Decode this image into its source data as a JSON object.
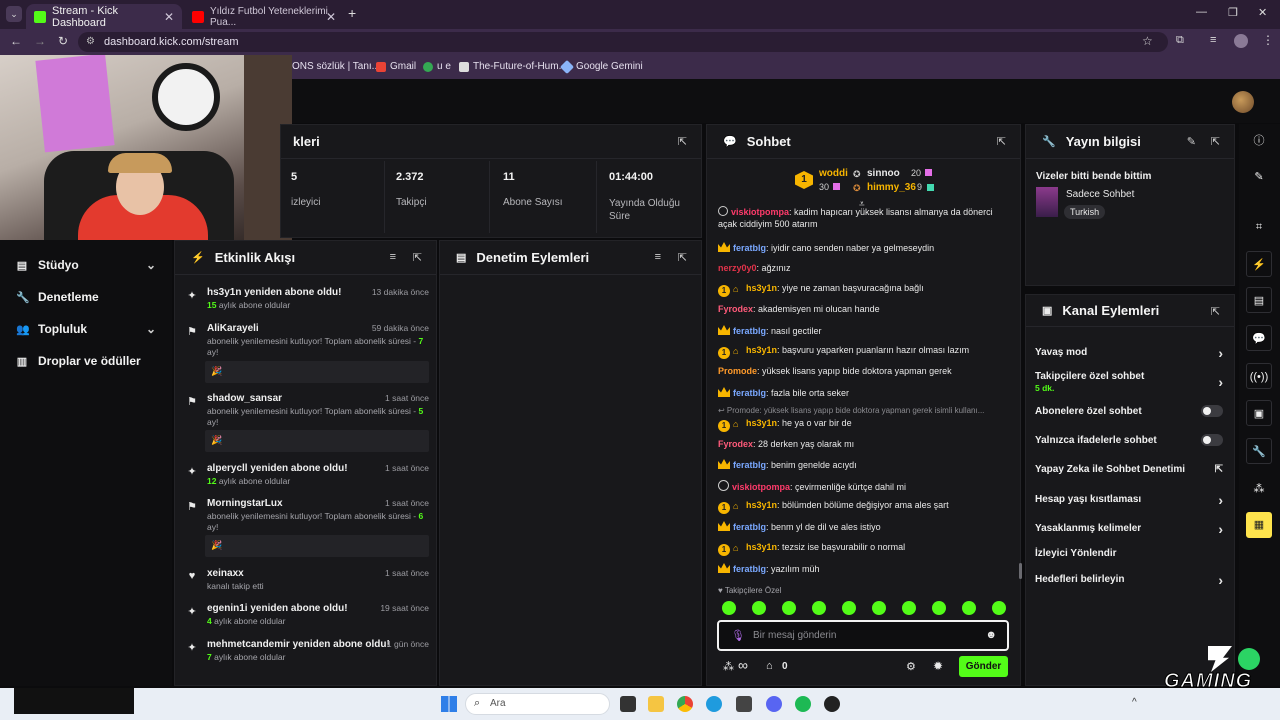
{
  "browser": {
    "tabs": [
      {
        "title": "Stream - Kick Dashboard",
        "active": true
      },
      {
        "title": "Yıldız Futbol Yeteneklerimi Pua...",
        "active": false
      }
    ],
    "new_tab_symbol": "+",
    "url": "dashboard.kick.com/stream",
    "bookmarks": [
      "ONS sözlük | Tanı...",
      "Gmail",
      "u e",
      "The-Future-of-Hum...",
      "Google Gemini"
    ]
  },
  "sidebar": {
    "items": [
      {
        "label": "Stüdyo",
        "icon": "studio-icon",
        "expandable": true
      },
      {
        "label": "Denetleme",
        "icon": "wrench-icon",
        "expandable": false
      },
      {
        "label": "Topluluk",
        "icon": "people-icon",
        "expandable": true
      },
      {
        "label": "Droplar ve ödüller",
        "icon": "chart-icon",
        "expandable": false
      }
    ]
  },
  "stats_panel": {
    "title": "kleri",
    "stats": [
      {
        "value": "5",
        "label": "izleyici"
      },
      {
        "value": "2.372",
        "label": "Takipçi"
      },
      {
        "value": "11",
        "label": "Abone Sayısı"
      },
      {
        "value": "01:44:00",
        "label": "Yayında Olduğu Süre"
      }
    ]
  },
  "activity": {
    "title": "Etkinlik Akışı",
    "items": [
      {
        "name": "hs3y1n yeniden abone oldu!",
        "time": "13 dakika önce",
        "num": "15",
        "sub": " aylık abone oldular",
        "icon": "sparkle-icon"
      },
      {
        "name": "AliKarayeli",
        "time": "59 dakika önce",
        "sub": "abonelik yenilemesini kutluyor! Toplam abonelik süresi - ",
        "num": "7",
        "suffix": " ay!",
        "box": "🎉",
        "icon": "celebrate-icon"
      },
      {
        "name": "shadow_sansar",
        "time": "1 saat önce",
        "sub": "abonelik yenilemesini kutluyor! Toplam abonelik süresi - ",
        "num": "5",
        "suffix": " ay!",
        "box": "🎉",
        "icon": "celebrate-icon"
      },
      {
        "name": "alperycll yeniden abone oldu!",
        "time": "1 saat önce",
        "num": "12",
        "sub": " aylık abone oldular",
        "icon": "sparkle-icon"
      },
      {
        "name": "MorningstarLux",
        "time": "1 saat önce",
        "sub": "abonelik yenilemesini kutluyor! Toplam abonelik süresi - ",
        "num": "6",
        "suffix": " ay!",
        "box": "🎉",
        "icon": "celebrate-icon"
      },
      {
        "name": "xeinaxx",
        "time": "1 saat önce",
        "sub": "kanalı takip etti",
        "icon": "heart-icon"
      },
      {
        "name": "egenin1i yeniden abone oldu!",
        "time": "19 saat önce",
        "num": "4",
        "sub": " aylık abone oldular",
        "icon": "sparkle-icon"
      },
      {
        "name": "mehmetcandemir yeniden abone oldu!",
        "time": "1 gün önce",
        "num": "7",
        "sub": " aylık abone oldular",
        "icon": "sparkle-icon"
      }
    ]
  },
  "moderation": {
    "title": "Denetim Eylemleri"
  },
  "chat": {
    "title": "Sohbet",
    "leaderboard": [
      {
        "name": "woddi",
        "value": "30",
        "rank": "1"
      },
      {
        "name": "sinnoo",
        "value": "20"
      },
      {
        "name": "himmy_36",
        "value": "9"
      }
    ],
    "messages": [
      {
        "user": "viskiotpompa",
        "color": "#ff3b6b",
        "text": ": kadim hapıcarı yüksek lisansı almanya da dönerci açak ciddiyim 500 atarım",
        "badge": "h"
      },
      {
        "user": "feratblg",
        "color": "#7aa8ff",
        "text": ": iyidir cano senden naber ya gelmeseydin",
        "badge": "crown"
      },
      {
        "user": "nerzy0y0",
        "color": "#e0334a",
        "text": ": ağzınız",
        "badge": ""
      },
      {
        "user": "hs3y1n",
        "color": "#f7b500",
        "text": ": yiye ne zaman başvuracağına bağlı",
        "badge": "coin"
      },
      {
        "user": "Fyrodex",
        "color": "#ff5a7a",
        "text": ": akademisyen mi olucan hande",
        "badge": ""
      },
      {
        "user": "feratblg",
        "color": "#7aa8ff",
        "text": ": nasıl gectiler",
        "badge": "crown"
      },
      {
        "user": "hs3y1n",
        "color": "#f7b500",
        "text": ": başvuru yaparken puanların hazır olması lazım",
        "badge": "coin"
      },
      {
        "user": "Promode",
        "color": "#ff9a2a",
        "text": ": yüksek lisans yapıp bide doktora yapman gerek",
        "badge": ""
      },
      {
        "user": "feratblg",
        "color": "#7aa8ff",
        "text": ": fazla bile orta seker",
        "badge": "crown"
      },
      {
        "user": "↩ Promode: yüksek lisans yapıp bide doktora yapman gerek isimli kullanı...",
        "color": "#8b8b90",
        "text": "",
        "badge": "reply"
      },
      {
        "user": "hs3y1n",
        "color": "#f7b500",
        "text": ": he ya o var bir de",
        "badge": "coin"
      },
      {
        "user": "Fyrodex",
        "color": "#ff5a7a",
        "text": ": 28 derken yaş olarak mı",
        "badge": ""
      },
      {
        "user": "feratblg",
        "color": "#7aa8ff",
        "text": ": benim genelde acıydı",
        "badge": "crown"
      },
      {
        "user": "viskiotpompa",
        "color": "#ff3b6b",
        "text": ": çevirmenliğe kürtçe dahil mi",
        "badge": "h"
      },
      {
        "user": "hs3y1n",
        "color": "#f7b500",
        "text": ": bölümden bölüme değişiyor ama ales şart",
        "badge": "coin"
      },
      {
        "user": "feratblg",
        "color": "#7aa8ff",
        "text": ": benm yl de dil ve ales istiyo",
        "badge": "crown"
      },
      {
        "user": "hs3y1n",
        "color": "#f7b500",
        "text": ": tezsiz ise başvurabilir o normal",
        "badge": "coin"
      },
      {
        "user": "feratblg",
        "color": "#7aa8ff",
        "text": ": yazılım müh",
        "badge": "crown"
      }
    ],
    "followers_only_label": "Takipçilere Özel",
    "input_placeholder": "Bir mesaj gönderin",
    "points_symbol": "∞",
    "shop_count": "0",
    "send_label": "Gönder"
  },
  "stream_info": {
    "title": "Yayın bilgisi",
    "stream_title": "Vizeler bitti bende bittim",
    "category": "Sadece Sohbet",
    "tag": "Turkish"
  },
  "channel_actions": {
    "title": "Kanal Eylemleri",
    "items": [
      {
        "label": "Yavaş mod",
        "control": "chevron"
      },
      {
        "label": "Takipçilere özel sohbet",
        "sub": "5 dk.",
        "control": "chevron"
      },
      {
        "label": "Abonelere özel sohbet",
        "control": "toggle"
      },
      {
        "label": "Yalnızca ifadelerle sohbet",
        "control": "toggle"
      },
      {
        "label": "Yapay Zeka ile Sohbet Denetimi",
        "control": "external"
      },
      {
        "label": "Hesap yaşı kısıtlaması",
        "control": "chevron"
      },
      {
        "label": "Yasaklanmış kelimeler",
        "control": "chevron"
      },
      {
        "label": "İzleyici Yönlendir",
        "control": "none"
      },
      {
        "label": "Hedefleri belirleyin",
        "control": "chevron"
      }
    ]
  },
  "taskbar": {
    "search_placeholder": "Ara",
    "overlay_logo": "GAMING"
  },
  "colors": {
    "accent": "#53fc18",
    "panel": "#18181b",
    "bg": "#0b0b0d",
    "gold": "#f7b500"
  }
}
